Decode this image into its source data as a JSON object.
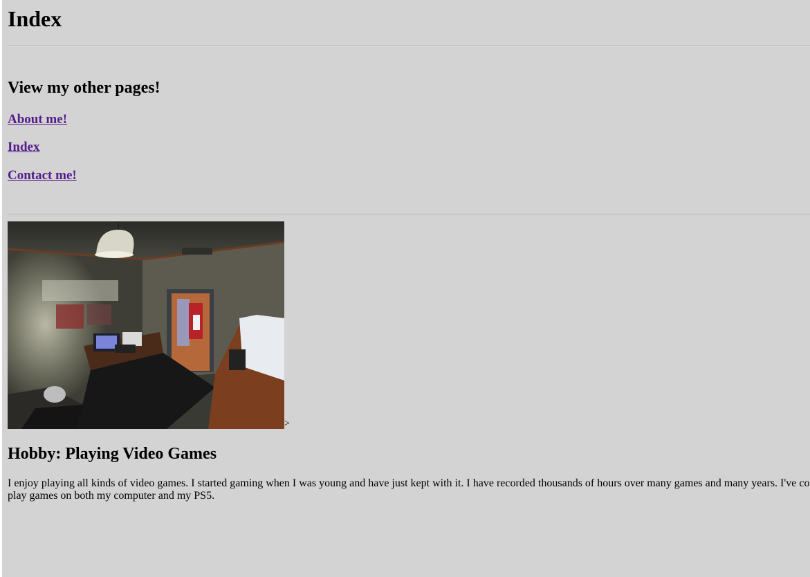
{
  "header": {
    "title": "Index"
  },
  "nav": {
    "heading": "View my other pages!",
    "links": [
      {
        "label": "About me!"
      },
      {
        "label": "Index"
      },
      {
        "label": "Contact me!"
      }
    ]
  },
  "photo": {
    "subject": "gaming-room-photo"
  },
  "stray_text": ">",
  "hobby": {
    "heading": "Hobby: Playing Video Games",
    "text_line1": "I enjoy playing all kinds of video games. I started gaming when I was young and have just kept with it. I have recorded thousands of hours over many games and many years. I've co",
    "text_line2": "play games on both my computer and my PS5."
  },
  "colors": {
    "background": "#d3d3d3",
    "link_visited": "#551a8b"
  }
}
